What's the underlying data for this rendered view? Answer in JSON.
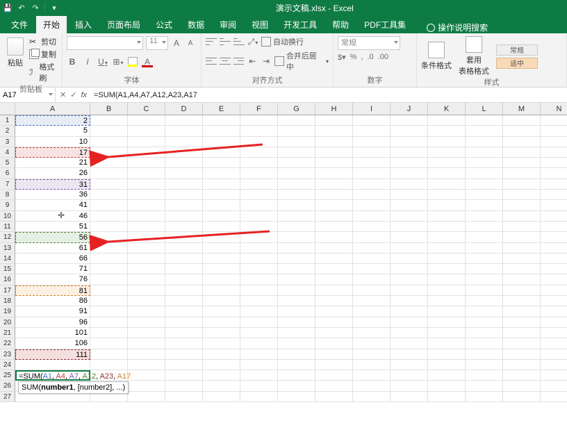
{
  "titlebar": {
    "title": "演示文稿.xlsx - Excel"
  },
  "tabs": {
    "file": "文件",
    "home": "开始",
    "insert": "插入",
    "layout": "页面布局",
    "formulas": "公式",
    "data": "数据",
    "review": "审阅",
    "view": "视图",
    "dev": "开发工具",
    "help": "帮助",
    "pdf": "PDF工具集",
    "tellme": "操作说明搜索"
  },
  "ribbon": {
    "clipboard": {
      "paste": "粘贴",
      "cut": "剪切",
      "copy": "复制",
      "format_painter": "格式刷",
      "label": "剪贴板"
    },
    "font": {
      "size": "11",
      "label": "字体"
    },
    "alignment": {
      "wrap": "自动换行",
      "merge": "合并后居中",
      "label": "对齐方式"
    },
    "number": {
      "format": "常规",
      "label": "数字"
    },
    "styles": {
      "cond": "条件格式",
      "table": "套用\n表格格式",
      "general": "常规",
      "neutral": "适中",
      "label": "样式"
    }
  },
  "namebox": {
    "ref": "A17"
  },
  "formula_bar": {
    "value": "=SUM(A1,A4,A7,A12,A23,A17"
  },
  "grid": {
    "columns": [
      "A",
      "B",
      "C",
      "D",
      "E",
      "F",
      "G",
      "H",
      "I",
      "J",
      "K",
      "L",
      "M",
      "N"
    ],
    "rows": [
      {
        "n": 1,
        "a": "2"
      },
      {
        "n": 2,
        "a": "5"
      },
      {
        "n": 3,
        "a": "10"
      },
      {
        "n": 4,
        "a": "17"
      },
      {
        "n": 5,
        "a": "21"
      },
      {
        "n": 6,
        "a": "26"
      },
      {
        "n": 7,
        "a": "31"
      },
      {
        "n": 8,
        "a": "36"
      },
      {
        "n": 9,
        "a": "41"
      },
      {
        "n": 10,
        "a": "46"
      },
      {
        "n": 11,
        "a": "51"
      },
      {
        "n": 12,
        "a": "56"
      },
      {
        "n": 13,
        "a": "61"
      },
      {
        "n": 14,
        "a": "66"
      },
      {
        "n": 15,
        "a": "71"
      },
      {
        "n": 16,
        "a": "76"
      },
      {
        "n": 17,
        "a": "81"
      },
      {
        "n": 18,
        "a": "86"
      },
      {
        "n": 19,
        "a": "91"
      },
      {
        "n": 20,
        "a": "96"
      },
      {
        "n": 21,
        "a": "101"
      },
      {
        "n": 22,
        "a": "106"
      },
      {
        "n": 23,
        "a": "111"
      },
      {
        "n": 24,
        "a": ""
      },
      {
        "n": 25,
        "a": ""
      },
      {
        "n": 26,
        "a": ""
      },
      {
        "n": 27,
        "a": ""
      }
    ],
    "formula_cell": {
      "prefix": "=SUM(",
      "args": [
        {
          "text": "A1",
          "class": "f-blue"
        },
        {
          "text": "A4",
          "class": "f-red"
        },
        {
          "text": "A7",
          "class": "f-purple"
        },
        {
          "text": "A12",
          "class": "f-green"
        },
        {
          "text": "A23",
          "class": "f-darkred"
        },
        {
          "text": "A17",
          "class": "f-orange"
        }
      ]
    },
    "tooltip": "SUM(number1, [number2], ...)",
    "highlights": {
      "1": "hl-blue",
      "4": "hl-red",
      "7": "hl-purple",
      "12": "hl-green",
      "17": "hl-orange",
      "23": "hl-darkred"
    },
    "active_row": 25
  }
}
